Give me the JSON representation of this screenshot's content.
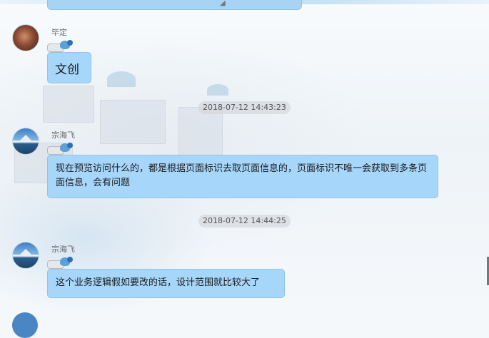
{
  "messages": [
    {
      "sender": "毕定",
      "text": "文创"
    },
    {
      "timestamp": "2018-07-12 14:43:23"
    },
    {
      "sender": "宗海飞",
      "text": "现在预览访问什么的，都是根据页面标识去取页面信息的，页面标识不唯一会获取到多条页面信息，会有问题"
    },
    {
      "timestamp": "2018-07-12 14:44:25"
    },
    {
      "sender": "宗海飞",
      "text": "这个业务逻辑假如要改的话，设计范围就比较大了"
    }
  ],
  "colors": {
    "bubble": "#a7d6fb",
    "bubble_border": "#90c3ea",
    "timestamp_bg": "#d2d6da"
  },
  "icons": [
    "avatar-photo",
    "avatar-mountain",
    "user-level-badge"
  ]
}
